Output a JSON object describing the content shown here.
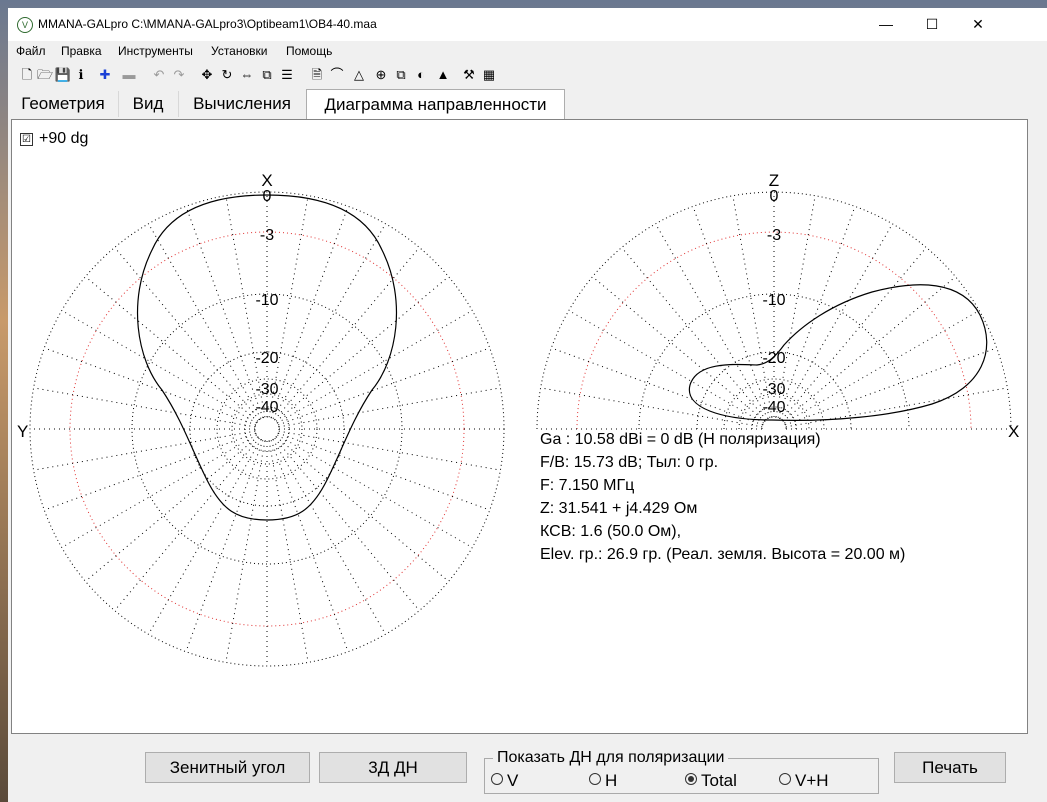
{
  "window": {
    "title": "MMANA-GALpro C:\\MMANA-GALpro3\\Optibeam1\\OB4-40.maa",
    "minimize": "—",
    "maximize": "☐",
    "close": "✕"
  },
  "menu": [
    "Файл",
    "Правка",
    "Инструменты",
    "Установки",
    "Помощь"
  ],
  "toolbar_icons": [
    "new-file-icon",
    "open-folder-icon",
    "save-icon",
    "info-icon",
    "add-icon",
    "remove-icon",
    "undo-icon",
    "redo-icon",
    "move-icon",
    "rotate-icon",
    "stretch-icon",
    "copy-icon",
    "wires-icon",
    "page-icon",
    "chart-icon",
    "triangle-icon",
    "target-icon",
    "duplicate-icon",
    "sphere-icon",
    "color-pattern-icon",
    "tools-icon",
    "calculator-icon"
  ],
  "toolbar_glyphs": [
    "🗋",
    "🗁",
    "💾",
    "ℹ",
    "✚",
    "▬",
    "↶",
    "↷",
    "✥",
    "↻",
    "⇔",
    "⧉",
    "☰",
    "🗎",
    "⌒",
    "△",
    "⊕",
    "⧉",
    "◐",
    "▲",
    "⚒",
    "▦"
  ],
  "tabs": [
    "Геометрия",
    "Вид",
    "Вычисления",
    "Диаграмма направленности"
  ],
  "active_tab": 3,
  "checkbox": {
    "checked": true,
    "mark": "☑",
    "label": "+90 dg"
  },
  "azimuth": {
    "top_label": "X",
    "left_label": "Y",
    "ring_labels": [
      "0",
      "-3",
      "-10",
      "-20",
      "-30",
      "-40"
    ]
  },
  "elevation": {
    "top_label": "Z",
    "right_label": "X",
    "ring_labels": [
      "0",
      "-3",
      "-10",
      "-20",
      "-30",
      "-40"
    ]
  },
  "info_lines": [
    "Ga : 10.58 dBi = 0 dB  (H поляризация)",
    "F/B: 15.73 dB; Тыл: 0 гр.",
    "F: 7.150 МГц",
    "Z: 31.541 + j4.429 Ом",
    "КСВ: 1.6 (50.0 Ом),",
    "Elev. гр.: 26.9 гр. (Реал. земля. Высота = 20.00 м)"
  ],
  "buttons": {
    "zenith": "Зенитный угол",
    "view3d": "3Д   ДН",
    "print": "Печать"
  },
  "polarization": {
    "title": "Показать ДН для поляризации",
    "options": [
      "V",
      "H",
      "Total",
      "V+H"
    ],
    "selected": 2
  },
  "colors": {
    "grid_black": "#000000",
    "grid_red": "#e03030",
    "pattern": "#000000"
  }
}
